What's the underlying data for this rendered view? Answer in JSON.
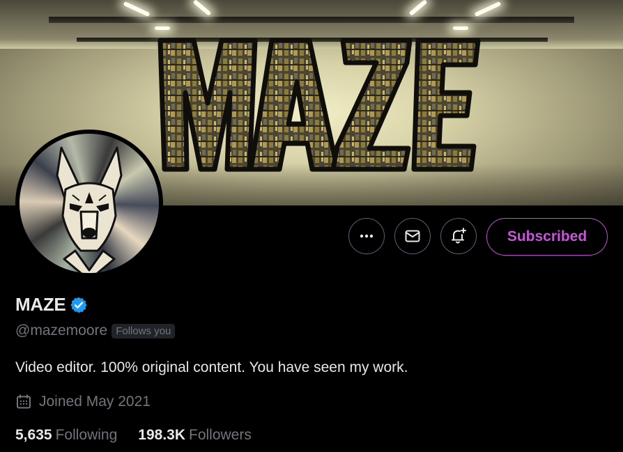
{
  "banner": {
    "logo_text": "MAZE"
  },
  "actions": {
    "more_icon": "more-horizontal-icon",
    "message_icon": "envelope-icon",
    "notify_icon": "bell-plus-icon",
    "subscribe_label": "Subscribed"
  },
  "profile": {
    "name": "MAZE",
    "verified_icon": "verified-badge-icon",
    "handle": "@mazemoore",
    "follows_you": "Follows you",
    "bio": "Video editor. 100% original content. You have seen my work.",
    "joined_icon": "calendar-icon",
    "joined": "Joined May 2021"
  },
  "stats": {
    "following_count": "5,635",
    "following_label": "Following",
    "followers_count": "198.3K",
    "followers_label": "Followers"
  },
  "colors": {
    "accent": "#c756d8",
    "verified": "#1d9bf0",
    "muted": "#71767b",
    "text": "#e7e9ea"
  }
}
